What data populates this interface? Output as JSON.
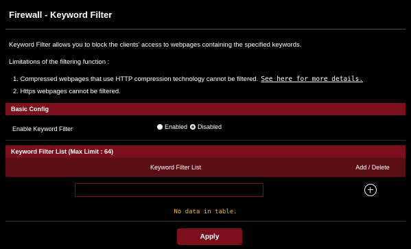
{
  "page": {
    "title": "Firewall - Keyword Filter",
    "description": "Keyword Filter allows you to block the clients' access to webpages containing the specified keywords.",
    "limitations_heading": "Limitations of the filtering function :",
    "limitations": [
      {
        "text": "1. Compressed webpages that use HTTP compression technology cannot be filtered.",
        "link": "See here for more details."
      },
      {
        "text": "2. Https webpages cannot be filtered."
      }
    ]
  },
  "basic_config": {
    "header": "Basic Config",
    "enable_label": "Enable Keyword Filter",
    "options": [
      {
        "label": "Enabled",
        "checked": false
      },
      {
        "label": "Disabled",
        "checked": true
      }
    ]
  },
  "keyword_list": {
    "header": "Keyword Filter List (Max Limit : 64)",
    "columns": [
      "Keyword Filter List",
      "Add / Delete"
    ],
    "input_value": "",
    "add_icon": "plus-circle-icon",
    "empty_message": "No data in table."
  },
  "actions": {
    "apply_label": "Apply"
  },
  "colors": {
    "accent": "#7b0f1b",
    "header_row": "#5a0d14",
    "background": "#000000",
    "empty_text": "#f2b632"
  }
}
